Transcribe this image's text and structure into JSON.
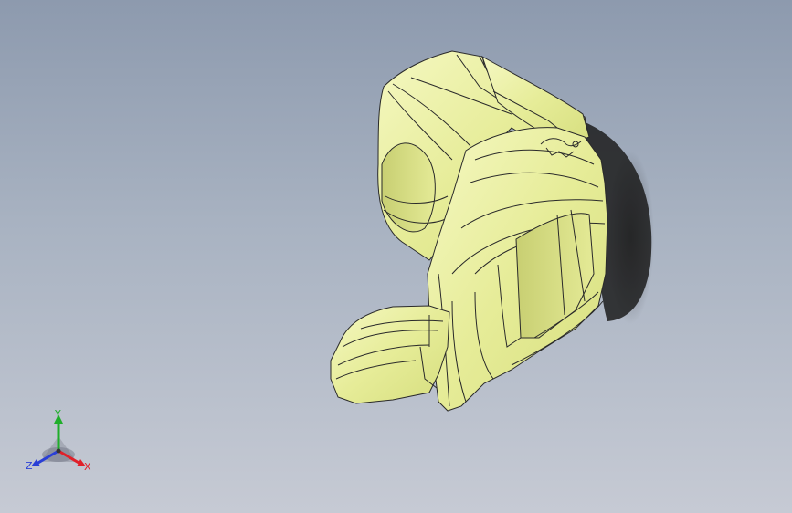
{
  "viewport": {
    "background_top": "#8d9aae",
    "background_bottom": "#c6cad4"
  },
  "model": {
    "surface_color": "#eef2a6",
    "edge_color": "#2a2a2a",
    "shadow_color": "#1c1c1c"
  },
  "triad": {
    "x_label": "X",
    "y_label": "Y",
    "z_label": "Z",
    "x_color": "#e0202a",
    "y_color": "#1fae2a",
    "z_color": "#2a3fd6"
  }
}
